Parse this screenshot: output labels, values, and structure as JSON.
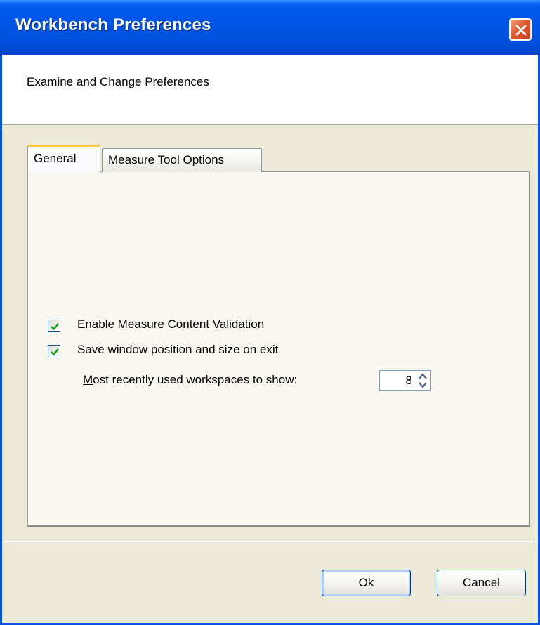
{
  "window": {
    "title": "Workbench Preferences",
    "header": "Examine and Change Preferences"
  },
  "tabs": [
    {
      "label": "General",
      "selected": true
    },
    {
      "label": "Measure Tool Options",
      "selected": false
    }
  ],
  "general": {
    "options": [
      {
        "label": "Enable Measure Content Validation",
        "checked": true
      },
      {
        "label": "Save window position and size on exit",
        "checked": true
      }
    ],
    "recent_workspaces": {
      "mnemonic": "M",
      "label_rest": "ost recently used workspaces to show:",
      "value": "8"
    }
  },
  "buttons": {
    "ok": "Ok",
    "cancel": "Cancel"
  },
  "colors": {
    "titlebar": "#0054e3",
    "window_bg": "#ece9d8",
    "check_green": "#21a121",
    "close_red": "#e2582e",
    "active_tab_highlight": "#ffc83c"
  },
  "icons": {
    "close": "close-icon",
    "checkmark": "checkmark-icon",
    "spin_up": "chevron-up-icon",
    "spin_down": "chevron-down-icon"
  }
}
